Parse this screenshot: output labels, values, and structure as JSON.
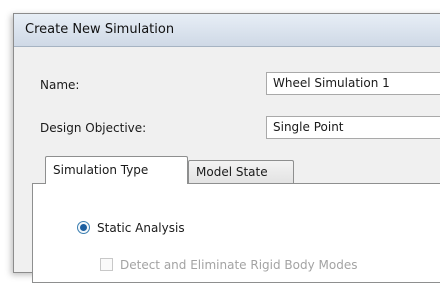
{
  "dialog": {
    "title": "Create New Simulation",
    "name_label": "Name:",
    "name_value": "Wheel Simulation 1",
    "objective_label": "Design Objective:",
    "objective_value": "Single Point",
    "tabs": [
      {
        "label": "Simulation Type",
        "active": true
      },
      {
        "label": "Model State",
        "active": false
      }
    ],
    "static_analysis_label": "Static Analysis",
    "static_analysis_selected": true,
    "rigid_body_label": "Detect and Eliminate Rigid Body Modes",
    "rigid_body_checked": false
  }
}
